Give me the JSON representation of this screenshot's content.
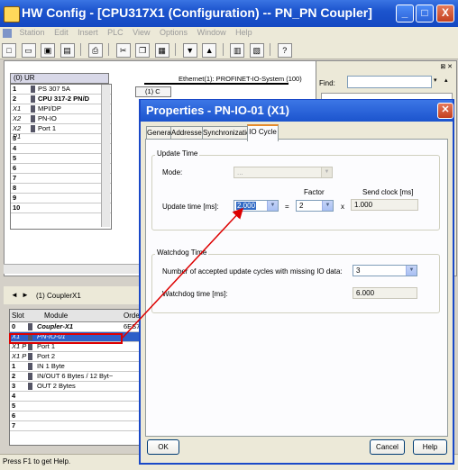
{
  "window": {
    "title": "HW Config - [CPU317X1 (Configuration) -- PN_PN Coupler]",
    "minimize": "_",
    "maximize": "□",
    "close": "X"
  },
  "menu": [
    "Station",
    "Edit",
    "Insert",
    "PLC",
    "View",
    "Options",
    "Window",
    "Help"
  ],
  "toolbar_icons": [
    "new-icon",
    "open-icon",
    "save-icon",
    "save-compile-icon",
    "print-icon",
    "cut-icon",
    "copy-icon",
    "paste-icon",
    "download-icon",
    "upload-icon",
    "catalog-icon",
    "network-icon",
    "help-icon"
  ],
  "rack": {
    "title": "(0) UR",
    "rows": [
      {
        "slot": "1",
        "module": "PS 307 5A",
        "bold": false
      },
      {
        "slot": "2",
        "module": "CPU 317-2 PN/D",
        "bold": true
      },
      {
        "slot": "X1",
        "module": "MPI/DP",
        "bold": false
      },
      {
        "slot": "X2",
        "module": "PN-IO",
        "bold": false
      },
      {
        "slot": "X2 P1",
        "module": "Port 1",
        "bold": false
      },
      {
        "slot": "3",
        "module": "",
        "bold": false
      },
      {
        "slot": "4",
        "module": "",
        "bold": false
      },
      {
        "slot": "5",
        "module": "",
        "bold": false
      },
      {
        "slot": "6",
        "module": "",
        "bold": false
      },
      {
        "slot": "7",
        "module": "",
        "bold": false
      },
      {
        "slot": "8",
        "module": "",
        "bold": false
      },
      {
        "slot": "9",
        "module": "",
        "bold": false
      },
      {
        "slot": "10",
        "module": "",
        "bold": false
      }
    ]
  },
  "network": {
    "ethernet_label": "Ethernet(1): PROFINET-IO-System (100)",
    "device_label": "(1) C"
  },
  "catalog": {
    "find_label": "Find:",
    "find_value": ""
  },
  "detail": {
    "title": "(1)   CouplerX1",
    "headers": {
      "slot": "Slot",
      "module": "Module",
      "order": "Order"
    },
    "rows": [
      {
        "slot": "0",
        "module": "Coupler-X1",
        "order": "6ES7",
        "bold": true,
        "selected": false
      },
      {
        "slot": "X1",
        "module": "PN-IO-01",
        "order": "",
        "bold": false,
        "selected": true
      },
      {
        "slot": "X1 P",
        "module": "Port 1",
        "order": "",
        "bold": false,
        "selected": false
      },
      {
        "slot": "X1 P",
        "module": "Port 2",
        "order": "",
        "bold": false,
        "selected": false
      },
      {
        "slot": "1",
        "module": "IN  1 Byte",
        "order": "",
        "bold": false,
        "selected": false
      },
      {
        "slot": "2",
        "module": "IN/OUT 6 Bytes / 12 Byt~",
        "order": "",
        "bold": false,
        "selected": false
      },
      {
        "slot": "3",
        "module": "OUT  2 Bytes",
        "order": "",
        "bold": false,
        "selected": false
      },
      {
        "slot": "4",
        "module": "",
        "order": "",
        "bold": false,
        "selected": false
      },
      {
        "slot": "5",
        "module": "",
        "order": "",
        "bold": false,
        "selected": false
      },
      {
        "slot": "6",
        "module": "",
        "order": "",
        "bold": false,
        "selected": false
      },
      {
        "slot": "7",
        "module": "",
        "order": "",
        "bold": false,
        "selected": false
      }
    ]
  },
  "status": "Press F1 to get Help.",
  "dialog": {
    "title": "Properties - PN-IO-01 (X1)",
    "tabs": [
      "General",
      "Addresses",
      "Synchronization",
      "IO Cycle"
    ],
    "active_tab": "IO Cycle",
    "update_time": {
      "group_label": "Update Time",
      "mode_label": "Mode:",
      "mode_value": "...",
      "factor_label": "Factor",
      "send_clock_label": "Send clock [ms]",
      "update_label": "Update time [ms]:",
      "update_value": "2.000",
      "equals": "=",
      "factor_value": "2",
      "times": "x",
      "send_clock_value": "1.000"
    },
    "watchdog": {
      "group_label": "Watchdog Time",
      "cycles_label": "Number of accepted update cycles with missing IO data:",
      "cycles_value": "3",
      "watchdog_label": "Watchdog time [ms]:",
      "watchdog_value": "6.000"
    },
    "buttons": {
      "ok": "OK",
      "cancel": "Cancel",
      "help": "Help"
    }
  },
  "colors": {
    "title_blue": "#1c54cd",
    "selection_blue": "#2d5fc8",
    "annotation_red": "#dd0000",
    "active_tab_accent": "#e68b2c"
  }
}
